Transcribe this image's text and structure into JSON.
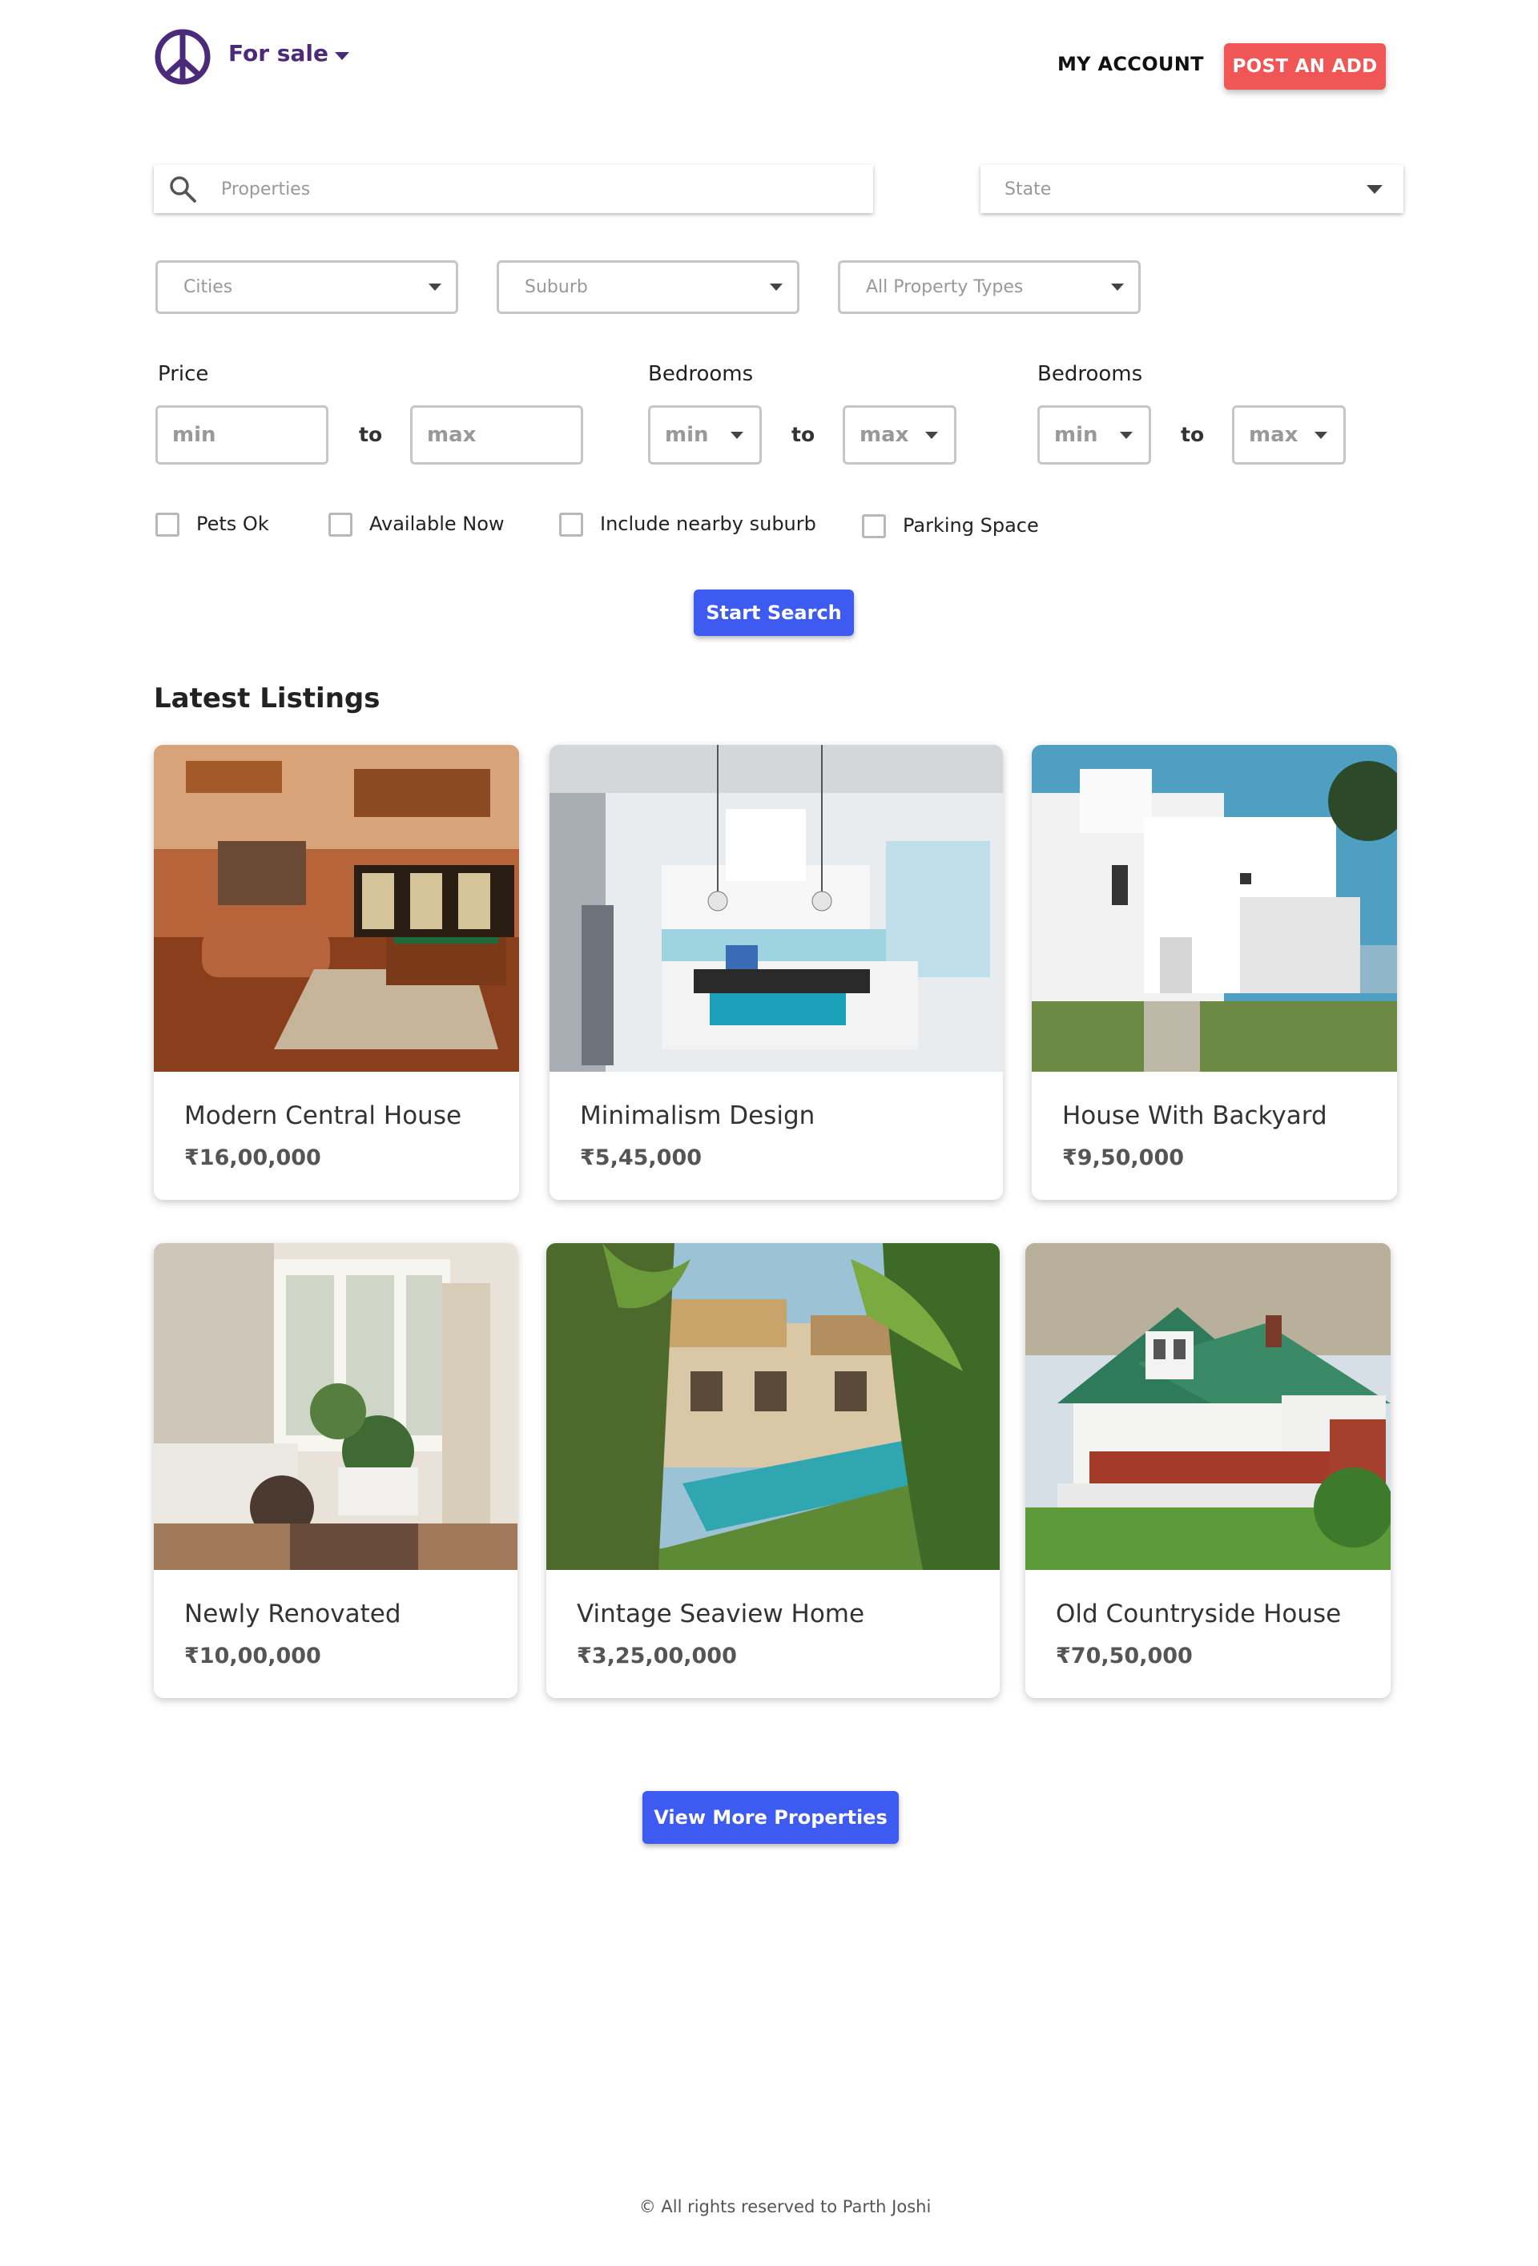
{
  "header": {
    "brand": "For sale",
    "account": "MY ACCOUNT",
    "post_ad": "POST AN ADD",
    "logo_icon": "peace-icon",
    "brand_color": "#4a2a7a",
    "post_color": "#f05656"
  },
  "search": {
    "placeholder": "Properties",
    "state": "State",
    "cities": "Cities",
    "suburb": "Suburb",
    "property_types": "All Property Types"
  },
  "filters": {
    "price_label": "Price",
    "bedrooms_label_1": "Bedrooms",
    "bedrooms_label_2": "Bedrooms",
    "min": "min",
    "max": "max",
    "to": "to"
  },
  "checkboxes": [
    "Pets Ok",
    "Available Now",
    "Include nearby suburb",
    "Parking Space"
  ],
  "start_search": "Start Search",
  "section_title": "Latest Listings",
  "listings": [
    {
      "title": "Modern Central House",
      "price": "₹16,00,000"
    },
    {
      "title": "Minimalism Design",
      "price": "₹5,45,000"
    },
    {
      "title": "House With Backyard",
      "price": "₹9,50,000"
    },
    {
      "title": "Newly Renovated",
      "price": "₹10,00,000"
    },
    {
      "title": "Vintage Seaview Home",
      "price": "₹3,25,00,000"
    },
    {
      "title": "Old Countryside House",
      "price": "₹70,50,000"
    }
  ],
  "view_more": "View More Properties",
  "accent_color": "#3d5af1",
  "footer": "© All rights reserved to Parth Joshi"
}
